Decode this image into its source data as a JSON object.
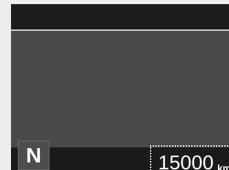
{
  "display": {
    "gear": "N",
    "odometer": {
      "value": "15000",
      "unit": "km"
    }
  }
}
